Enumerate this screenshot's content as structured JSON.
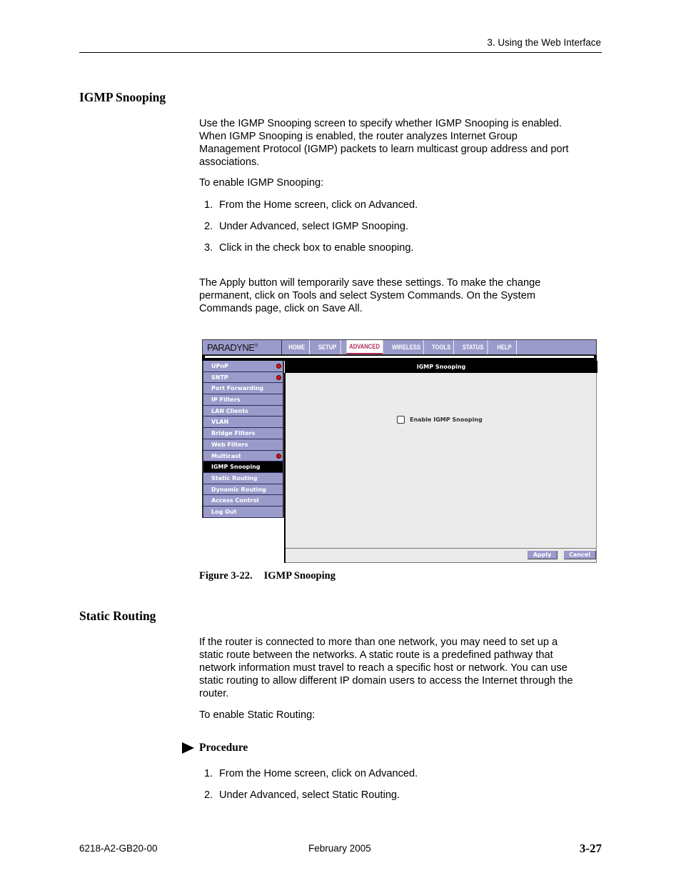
{
  "header": {
    "running_title": "3. Using the Web Interface"
  },
  "igmp_section": {
    "heading": "IGMP Snooping",
    "intro_lines": [
      "Use the IGMP Snooping screen to specify whether IGMP Snooping is enabled.",
      "When IGMP Snooping is enabled, the router analyzes Internet Group",
      "Management Protocol (IGMP) packets to learn multicast group address and port",
      "associations."
    ],
    "to_enable": "To enable IGMP Snooping:",
    "steps": [
      {
        "num": "1.",
        "text": "From the Home screen, click on Advanced."
      },
      {
        "num": "2.",
        "text": "Under Advanced, select IGMP Snooping."
      },
      {
        "num": "3.",
        "text": "Click in the check box to enable snooping."
      }
    ],
    "apply_note_lines": [
      "The Apply button will temporarily save these settings. To make the change",
      "permanent, click on Tools and select System Commands. On the System",
      "Commands page, click on Save All."
    ]
  },
  "figure": {
    "logo": "PARADYNE",
    "logo_mark": "®",
    "tabs": [
      {
        "label": "HOME",
        "active": false
      },
      {
        "label": "SETUP",
        "active": false
      },
      {
        "label": "ADVANCED",
        "active": true
      },
      {
        "label": "WIRELESS",
        "active": false
      },
      {
        "label": "TOOLS",
        "active": false
      },
      {
        "label": "STATUS",
        "active": false
      },
      {
        "label": "HELP",
        "active": false
      }
    ],
    "sidebar": [
      {
        "label": "UPnP",
        "alert": true
      },
      {
        "label": "SNTP",
        "alert": true
      },
      {
        "label": "Port Forwarding",
        "alert": false
      },
      {
        "label": "IP Filters",
        "alert": false
      },
      {
        "label": "LAN Clients",
        "alert": false
      },
      {
        "label": "VLAN",
        "alert": false
      },
      {
        "label": "Bridge Filters",
        "alert": false
      },
      {
        "label": "Web Filters",
        "alert": false
      },
      {
        "label": "Multicast",
        "alert": true
      },
      {
        "label": "IGMP Snooping",
        "alert": false,
        "active": true
      },
      {
        "label": "Static Routing",
        "alert": false
      },
      {
        "label": "Dynamic Routing",
        "alert": false
      },
      {
        "label": "Access Control",
        "alert": false
      },
      {
        "label": "Log Out",
        "alert": false
      }
    ],
    "page_title": "IGMP Snooping",
    "checkbox_label": "Enable IGMP Snooping",
    "checkbox_checked": false,
    "apply_label": "Apply",
    "cancel_label": "Cancel",
    "caption_num": "Figure 3-22.",
    "caption_title": "IGMP Snooping"
  },
  "static_section": {
    "heading": "Static Routing",
    "intro_lines": [
      "If the router is connected to more than one network, you may need to set up a",
      "static route between the networks. A static route is a predefined pathway that",
      "network information must travel to reach a specific host or network. You can use",
      "static routing to allow different IP domain users to access the Internet through the",
      "router."
    ],
    "to_enable": "To enable Static Routing:",
    "procedure_label": "Procedure",
    "steps": [
      {
        "num": "1.",
        "text": "From the Home screen, click on Advanced."
      },
      {
        "num": "2.",
        "text": "Under Advanced, select Static Routing."
      }
    ]
  },
  "footer": {
    "doc_number": "6218-A2-GB20-00",
    "date": "February 2005",
    "page_number": "3-27"
  },
  "colors": {
    "nav_lavender": "#9b9bcb",
    "active_tab_accent": "#b0305a",
    "alert_red": "#e01010"
  }
}
